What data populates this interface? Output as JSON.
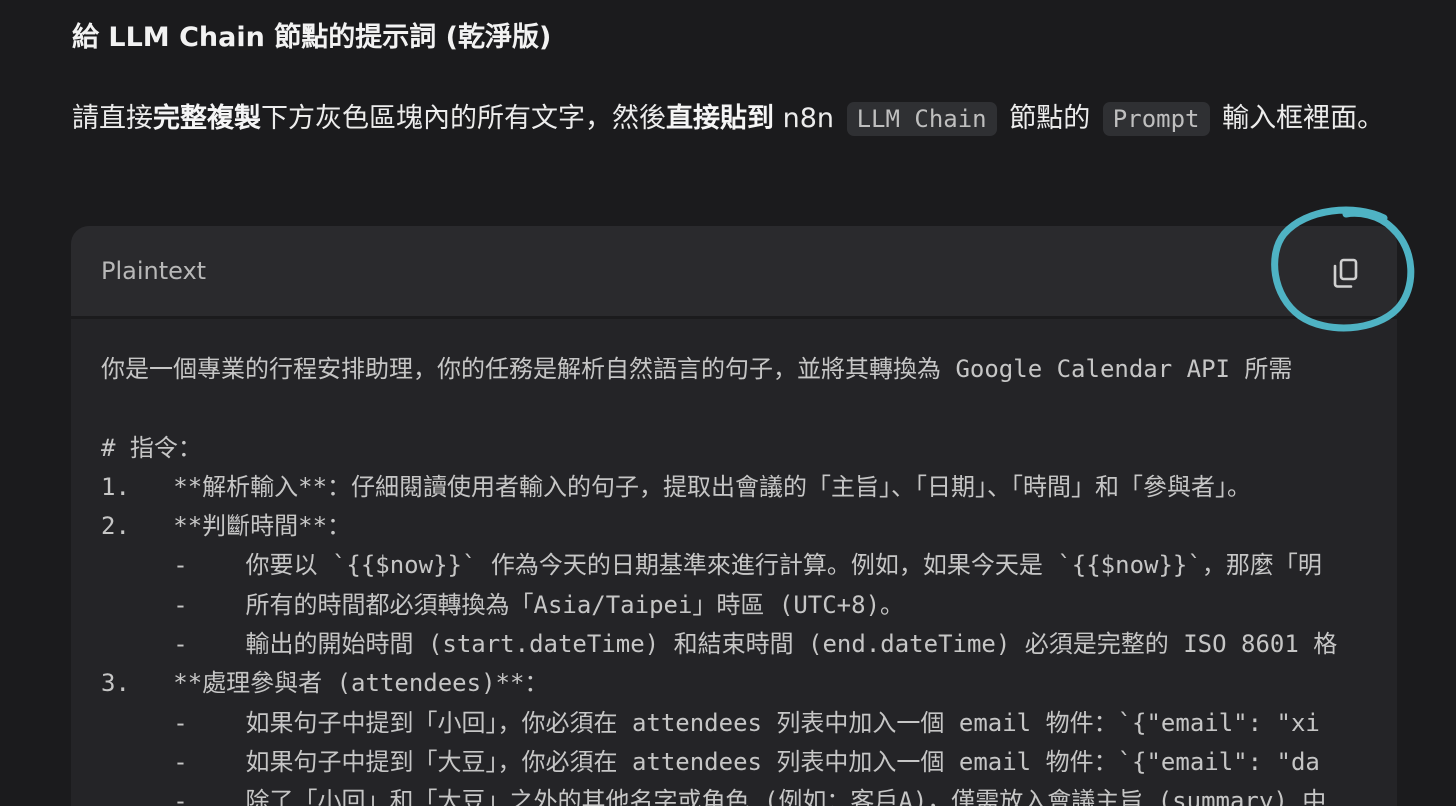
{
  "heading": "給 LLM Chain 節點的提示詞 (乾淨版)",
  "intro": {
    "part1": "請直接",
    "bold1": "完整複製",
    "part2": "下方灰色區塊內的所有文字，然後",
    "bold2": "直接貼到",
    "part3": " n8n ",
    "code1": "LLM Chain",
    "part4": " 節點的 ",
    "code2": "Prompt",
    "part5": " 輸入框裡面。"
  },
  "code_block": {
    "language": "Plaintext",
    "copy_icon": "copy-icon",
    "lines": [
      "你是一個專業的行程安排助理，你的任務是解析自然語言的句子，並將其轉換為 Google Calendar API 所需",
      "",
      "# 指令：",
      "1.   **解析輸入**：仔細閱讀使用者輸入的句子，提取出會議的「主旨」、「日期」、「時間」和「參與者」。",
      "2.   **判斷時間**：",
      "     -    你要以 `{{$now}}` 作為今天的日期基準來進行計算。例如，如果今天是 `{{$now}}`，那麼「明",
      "     -    所有的時間都必須轉換為「Asia/Taipei」時區 (UTC+8)。",
      "     -    輸出的開始時間 (start.dateTime) 和結束時間 (end.dateTime) 必須是完整的 ISO 8601 格",
      "3.   **處理參與者 (attendees)**：",
      "     -    如果句子中提到「小回」，你必須在 attendees 列表中加入一個 email 物件：`{\"email\": \"xi",
      "     -    如果句子中提到「大豆」，你必須在 attendees 列表中加入一個 email 物件：`{\"email\": \"da",
      "     -    除了「小回」和「大豆」之外的其他名字或角色 (例如：客戶A)，僅需放入會議主旨 (summary) 中"
    ]
  },
  "colors": {
    "page_bg": "#1b1b1d",
    "code_bg": "#242427",
    "annotation": "#4fb3c4"
  }
}
